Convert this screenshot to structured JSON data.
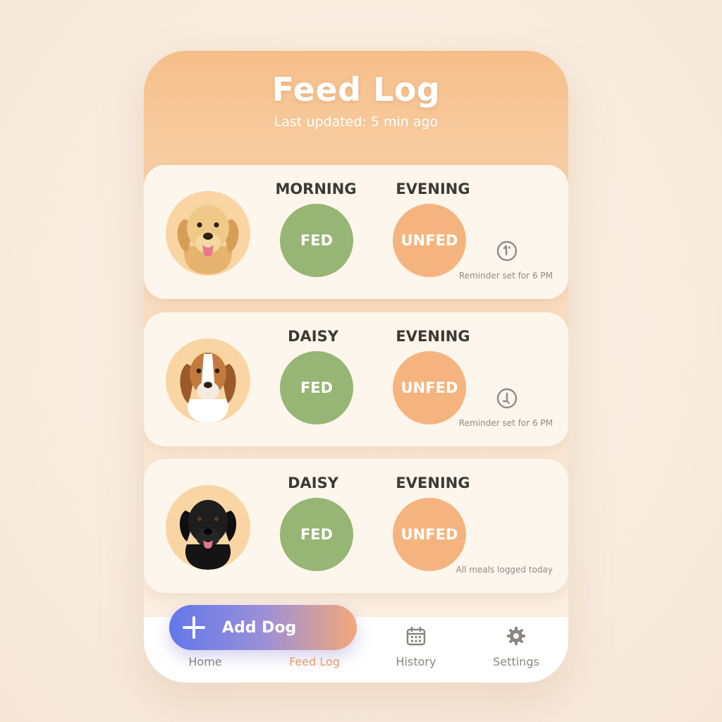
{
  "header": {
    "title": "Feed Log",
    "subtitle": "Last updated: 5 min ago"
  },
  "cards": [
    {
      "dog": "golden-retriever",
      "col1_label": "MORNING",
      "col1_status": "FED",
      "col2_label": "EVENING",
      "col2_status": "UNFED",
      "note": "Reminder set for 6 PM",
      "icon": "reminder-clock-icon"
    },
    {
      "dog": "beagle",
      "col1_label": "DAISY",
      "col1_status": "FED",
      "col2_label": "EVENING",
      "col2_status": "UNFED",
      "note": "Reminder set for 6 PM",
      "icon": "reminder-clock-icon"
    },
    {
      "dog": "black-labrador",
      "col1_label": "DAISY",
      "col1_status": "FED",
      "col2_label": "EVENING",
      "col2_status": "UNFED",
      "note": "All meals logged today"
    }
  ],
  "nav": {
    "items": [
      {
        "label": "Home",
        "icon": "home-icon"
      },
      {
        "label": "Feed Log",
        "icon": "feed-icon",
        "active": true
      },
      {
        "label": "History",
        "icon": "calendar-icon"
      },
      {
        "label": "Settings",
        "icon": "gear-icon"
      }
    ]
  },
  "fab": {
    "label": "Add Dog",
    "icon": "plus-icon"
  },
  "colors": {
    "fed": "#97b574",
    "unfed": "#f5b47f",
    "accent": "#f0a35c",
    "header": "#f6bf8a"
  }
}
